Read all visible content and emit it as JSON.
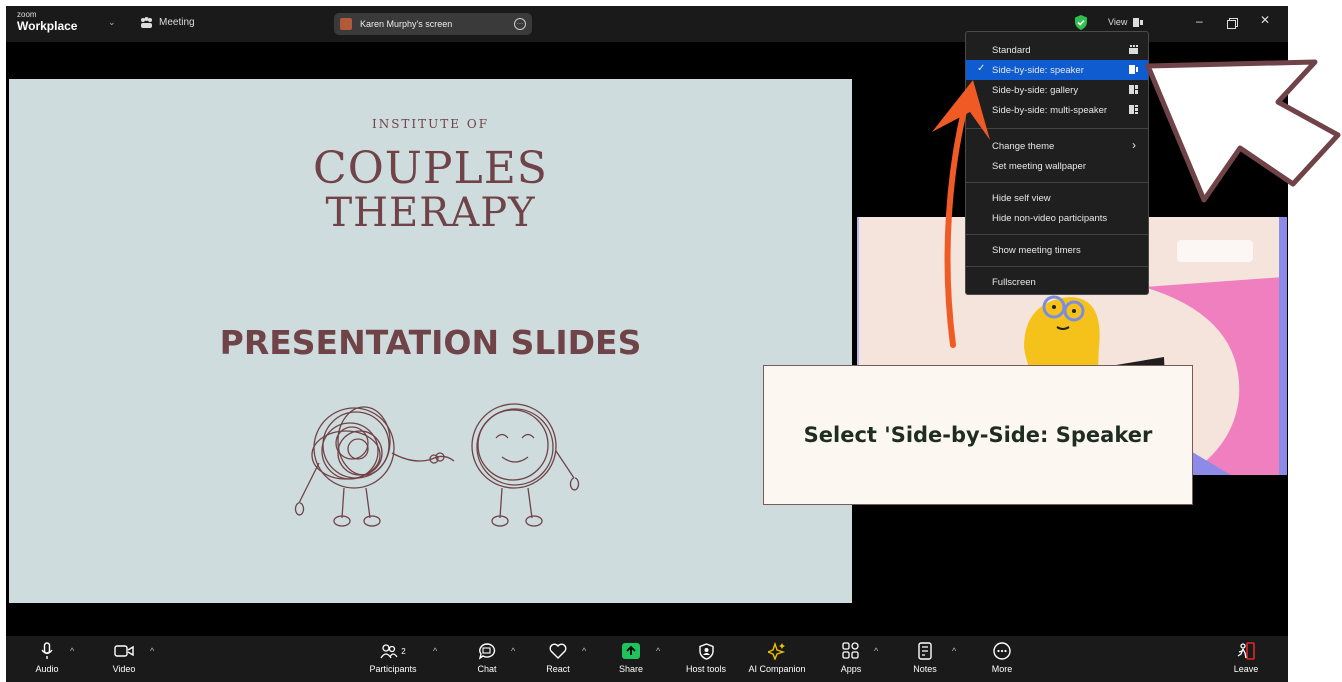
{
  "titlebar": {
    "logo_top": "zoom",
    "logo_bottom": "Workplace",
    "meeting_label": "Meeting",
    "screen_share_label": "Karen Murphy's screen",
    "view_label": "View"
  },
  "slide": {
    "institute": "INSTITUTE OF",
    "line1": "COUPLES",
    "line2": "THERAPY",
    "heading": "PRESENTATION SLIDES"
  },
  "view_menu": {
    "items": [
      {
        "label": "Standard",
        "selected": false
      },
      {
        "label": "Side-by-side: speaker",
        "selected": true
      },
      {
        "label": "Side-by-side: gallery",
        "selected": false
      },
      {
        "label": "Side-by-side: multi-speaker",
        "selected": false
      },
      {
        "label": "Change theme",
        "submenu": true
      },
      {
        "label": "Set meeting wallpaper"
      },
      {
        "label": "Hide self view"
      },
      {
        "label": "Hide non-video participants"
      },
      {
        "label": "Show meeting timers"
      },
      {
        "label": "Fullscreen"
      }
    ]
  },
  "toolbar": {
    "audio": "Audio",
    "video": "Video",
    "participants": "Participants",
    "participants_count": "2",
    "chat": "Chat",
    "react": "React",
    "share": "Share",
    "host_tools": "Host tools",
    "ai_companion": "AI Companion",
    "apps": "Apps",
    "notes": "Notes",
    "more": "More",
    "leave": "Leave"
  },
  "annotation": {
    "callout_text": "Select 'Side-by-Side: Speaker"
  },
  "colors": {
    "slide_bg": "#cfdcdd",
    "slide_text": "#6f4347",
    "menu_selected": "#0e5cd0",
    "share_green": "#1fc35b",
    "arrow_orange": "#f05a24",
    "ai_yellow": "#f2c200",
    "leave_red": "#e02828"
  },
  "icons": [
    "microphone-icon",
    "camera-icon",
    "participants-icon",
    "chat-icon",
    "react-icon",
    "share-icon",
    "host-tools-icon",
    "ai-companion-icon",
    "apps-icon",
    "notes-icon",
    "more-icon",
    "leave-icon",
    "shield-icon",
    "minimize-icon",
    "restore-icon",
    "close-icon"
  ]
}
